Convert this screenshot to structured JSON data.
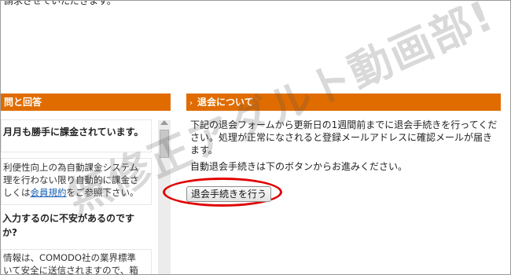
{
  "top_text": "請求させていただきます。",
  "left_panel": {
    "title": "問と回答",
    "faq": [
      {
        "question": "月月も勝手に課金されています。"
      },
      {
        "answer_lines": [
          "利便性向上の為自動課金システム",
          "理を行わない限り自動的に課金さ",
          "しくは",
          "会員規約",
          "をご参照下さい。"
        ]
      },
      {
        "question_lines": [
          "入力するのに不安があるのです",
          "か?"
        ]
      },
      {
        "answer_lines": [
          "情報は、COMODO社の業界標準",
          "いて安全に送信されますので、箱"
        ]
      }
    ]
  },
  "right_panel": {
    "title": "退会について",
    "description": "下記の退会フォームから更新日の1週間前までに退会手続きを行ってください。処理が正常になされると登録メールアドレスに確認メールが届きます。",
    "sub": "自動退会手続きは下のボタンからお進みください。",
    "button_label": "退会手続きを行う"
  },
  "watermark": "無修正アダルト動画部!",
  "colors": {
    "header": "#e06c00",
    "highlight": "#e00000",
    "link": "#1a5fb4"
  }
}
